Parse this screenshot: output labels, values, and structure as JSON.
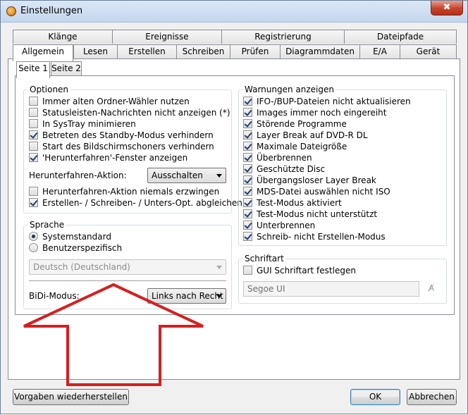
{
  "window": {
    "title": "Einstellungen",
    "close_symbol": "✖",
    "icon": "app-disc-icon"
  },
  "tabs": {
    "row1": [
      "Klänge",
      "Ereignisse",
      "Registrierung",
      "Dateipfade"
    ],
    "row2": [
      "Allgemein",
      "Lesen",
      "Erstellen",
      "Schreiben",
      "Prüfen",
      "Diagrammdaten",
      "E/A",
      "Gerät"
    ],
    "active": "Allgemein"
  },
  "subtabs": {
    "items": [
      "Seite 1",
      "Seite 2"
    ],
    "active": "Seite 1"
  },
  "optionen": {
    "title": "Optionen",
    "items": [
      {
        "label": "Immer alten Ordner-Wähler nutzen",
        "checked": false
      },
      {
        "label": "Statusleisten-Nachrichten nicht anzeigen (*)",
        "checked": false
      },
      {
        "label": "In SysTray minimieren",
        "checked": false
      },
      {
        "label": "Betreten des Standby-Modus verhindern",
        "checked": true
      },
      {
        "label": "Start des Bildschirmschoners verhindern",
        "checked": false
      },
      {
        "label": "'Herunterfahren'-Fenster anzeigen",
        "checked": true
      }
    ],
    "shutdown_label": "Herunterfahren-Aktion:",
    "shutdown_value": "Ausschalten",
    "items2": [
      {
        "label": "Herunterfahren-Aktion niemals erzwingen",
        "checked": false
      },
      {
        "label": "Erstellen- / Schreiben- / Unters-Opt. abgleichen",
        "checked": true
      }
    ]
  },
  "sprache": {
    "title": "Sprache",
    "radios": [
      {
        "label": "Systemstandard",
        "checked": true
      },
      {
        "label": "Benutzerspezifisch",
        "checked": false
      }
    ],
    "language_value": "Deutsch (Deutschland)",
    "bidi_label": "BiDi-Modus:",
    "bidi_value": "Links nach Recht"
  },
  "warnungen": {
    "title": "Warnungen anzeigen",
    "items": [
      {
        "label": "IFO-/BUP-Dateien nicht aktualisieren",
        "checked": true
      },
      {
        "label": "Images immer noch eingereiht",
        "checked": true
      },
      {
        "label": "Störende Programme",
        "checked": true
      },
      {
        "label": "Layer Break auf DVD-R DL",
        "checked": true
      },
      {
        "label": "Maximale Dateigröße",
        "checked": true
      },
      {
        "label": "Überbrennen",
        "checked": true
      },
      {
        "label": "Geschützte Disc",
        "checked": true
      },
      {
        "label": "Übergangsloser Layer Break",
        "checked": true
      },
      {
        "label": "MDS-Datei auswählen nicht ISO",
        "checked": true
      },
      {
        "label": "Test-Modus aktiviert",
        "checked": true
      },
      {
        "label": "Test-Modus nicht unterstützt",
        "checked": true
      },
      {
        "label": "Unterbrennen",
        "checked": true
      },
      {
        "label": "Schreib- nicht Erstellen-Modus",
        "checked": true
      }
    ]
  },
  "schriftart": {
    "title": "Schriftart",
    "checkbox_label": "GUI Schriftart festlegen",
    "checked": false,
    "font_value": "Segoe UI",
    "font_icon": "font-picker-icon"
  },
  "buttons": {
    "restore": "Vorgaben wiederherstellen",
    "ok": "OK",
    "cancel": "Abbrechen"
  },
  "colors": {
    "annotation_arrow": "#d42020",
    "accent": "#3c7fb1"
  }
}
